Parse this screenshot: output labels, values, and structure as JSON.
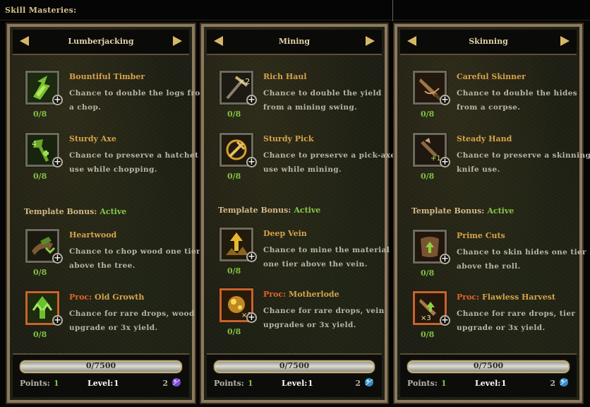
{
  "window_title": "Skill Masteries:",
  "panels": [
    {
      "title": "Lumberjacking",
      "skills": [
        {
          "name": "Bountiful Timber",
          "desc": "Chance to double the logs from a chop.",
          "count": "0/8",
          "icon": "lumber-bounty-icon"
        },
        {
          "name": "Sturdy Axe",
          "desc": "Chance to preserve a hatchet use while chopping.",
          "count": "0/8",
          "icon": "axe-icon"
        },
        {
          "name": "Heartwood",
          "desc": "Chance to chop wood one tier above the tree.",
          "count": "0/8",
          "icon": "heartwood-icon"
        },
        {
          "proc": "Proc:",
          "name": "Old Growth",
          "desc": "Chance for rare drops, wood upgrade or 3x yield.",
          "count": "0/8",
          "icon": "old-growth-icon"
        }
      ],
      "template_label": "Template Bonus:",
      "template_status": "Active",
      "xp": "0/7500",
      "points_label": "Points:",
      "points": "1",
      "level_label": "Level:",
      "level": "1",
      "gems": "2",
      "gem_color": "#7a4ad0"
    },
    {
      "title": "Mining",
      "skills": [
        {
          "name": "Rich Haul",
          "desc": "Chance to double the yield from a mining swing.",
          "count": "0/8",
          "icon": "pickaxe-x2-icon"
        },
        {
          "name": "Sturdy Pick",
          "desc": "Chance to preserve a pick-axe use while mining.",
          "count": "0/8",
          "icon": "pickaxe-refresh-icon"
        },
        {
          "name": "Deep Vein",
          "desc": "Chance to mine the material one tier above the vein.",
          "count": "0/8",
          "icon": "deep-vein-icon"
        },
        {
          "proc": "Proc:",
          "name": "Motherlode",
          "desc": "Chance for rare drops, vein upgrades or 3x yield.",
          "count": "0/8",
          "icon": "motherlode-icon"
        }
      ],
      "template_label": "Template Bonus:",
      "template_status": "Active",
      "xp": "0/7500",
      "points_label": "Points:",
      "points": "1",
      "level_label": "Level:",
      "level": "1",
      "gems": "2",
      "gem_color": "#4aa8d8"
    },
    {
      "title": "Skinning",
      "skills": [
        {
          "name": "Careful Skinner",
          "desc": "Chance to double the hides from a corpse.",
          "count": "0/8",
          "icon": "skinning-knife-icon"
        },
        {
          "name": "Steady Hand",
          "desc": "Chance to preserve a skinning knife use.",
          "count": "0/8",
          "icon": "steady-hand-icon"
        },
        {
          "name": "Prime Cuts",
          "desc": "Chance to skin hides one tier above the roll.",
          "count": "0/8",
          "icon": "hide-upgrade-icon"
        },
        {
          "proc": "Proc:",
          "name": "Flawless Harvest",
          "desc": "Chance for rare drops, tier upgrade or 3x yield.",
          "count": "0/8",
          "icon": "flawless-harvest-icon"
        }
      ],
      "template_label": "Template Bonus:",
      "template_status": "Active",
      "xp": "0/7500",
      "points_label": "Points:",
      "points": "1",
      "level_label": "Level:",
      "level": "1",
      "gems": "2",
      "gem_color": "#4aa8d8"
    }
  ]
}
